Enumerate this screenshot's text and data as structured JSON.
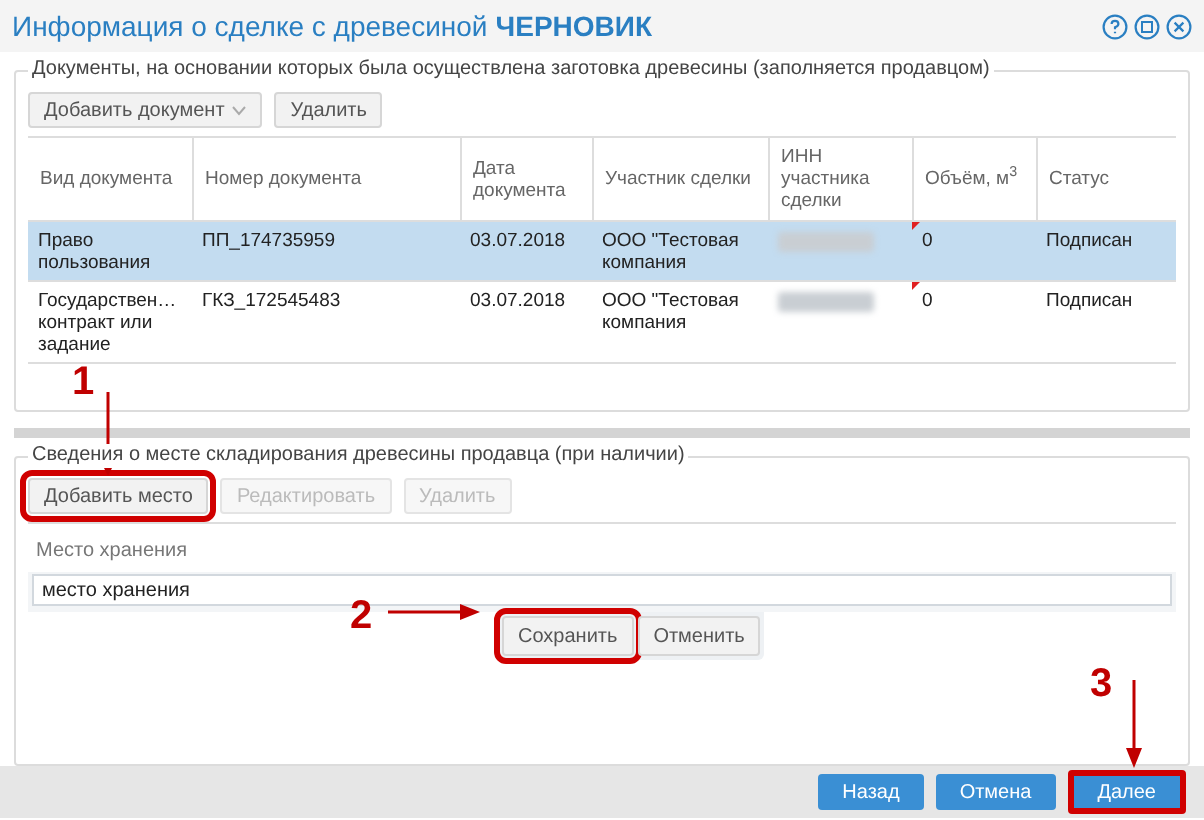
{
  "window": {
    "title": "Информация о сделке с древесиной",
    "status": "ЧЕРНОВИК"
  },
  "documents": {
    "legend": "Документы, на основании которых была осуществлена заготовка древесины (заполняется продавцом)",
    "toolbar": [
      {
        "label": "Добавить документ",
        "kind": "dropdown"
      },
      {
        "label": "Удалить",
        "kind": "button"
      }
    ],
    "table": {
      "columns": [
        "Вид документа",
        "Номер документа",
        "Дата документа",
        "Участник сделки",
        "ИНН участника сделки",
        "Объём, м$^{3}$",
        "Статус"
      ],
      "rows": [
        {
          "selected": true,
          "inn_redacted": true,
          "modified": true,
          "cells": [
            "Право пользования",
            "ПП_174735959",
            "03.07.2018",
            "ООО \"Тестовая компания",
            "",
            "0",
            "Подписан"
          ]
        },
        {
          "selected": false,
          "inn_redacted": true,
          "modified": true,
          "cells": [
            "Государствен… контракт или задание",
            "ГКЗ_172545483",
            "03.07.2018",
            "ООО \"Тестовая компания",
            "",
            "0",
            "Подписан"
          ]
        }
      ]
    }
  },
  "storage": {
    "legend": "Сведения о месте складирования древесины продавца (при наличии)",
    "toolbar": [
      {
        "label": "Добавить место",
        "disabled": false,
        "highlighted": true
      },
      {
        "label": "Редактировать",
        "disabled": true,
        "highlighted": false
      },
      {
        "label": "Удалить",
        "disabled": true,
        "highlighted": false
      }
    ],
    "field": {
      "label": "Место хранения",
      "value": "место хранения"
    },
    "form_buttons": [
      {
        "label": "Сохранить",
        "highlighted": true
      },
      {
        "label": "Отменить",
        "highlighted": false
      }
    ]
  },
  "footer_buttons": [
    {
      "label": "Назад",
      "highlighted": false
    },
    {
      "label": "Отмена",
      "highlighted": false
    },
    {
      "label": "Далее",
      "highlighted": true
    }
  ],
  "annotations": [
    "1",
    "2",
    "3"
  ]
}
